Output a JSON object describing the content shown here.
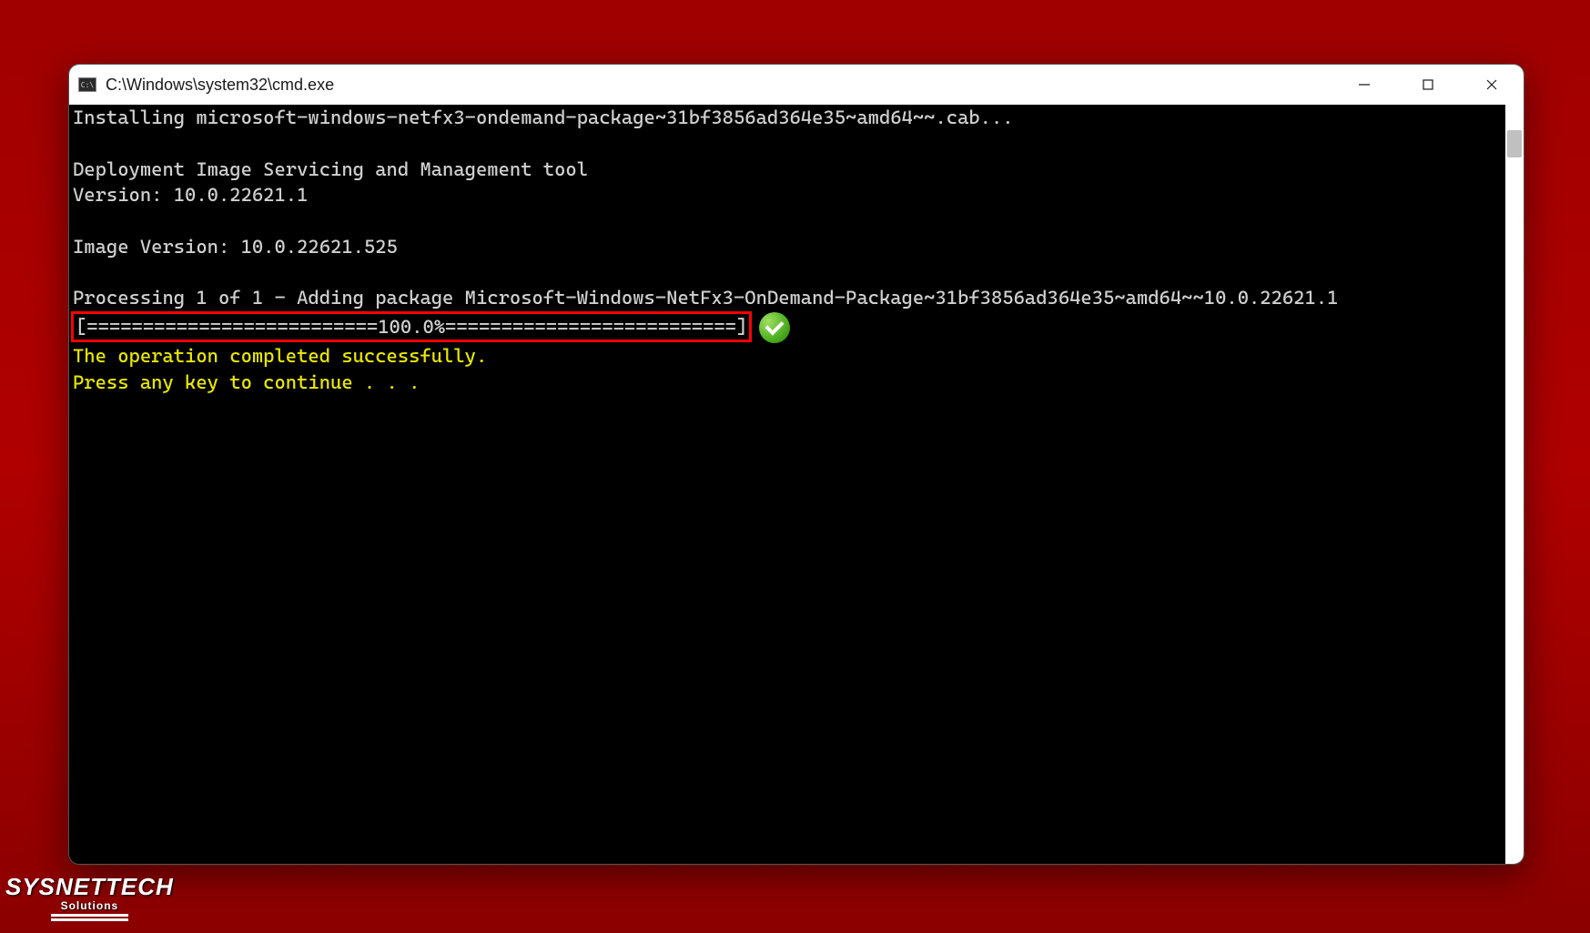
{
  "window": {
    "title": "C:\\Windows\\system32\\cmd.exe"
  },
  "terminal": {
    "line_installing": "Installing microsoft-windows-netfx3-ondemand-package~31bf3856ad364e35~amd64~~.cab...",
    "line_blank": "",
    "line_dism_title": "Deployment Image Servicing and Management tool",
    "line_version": "Version: 10.0.22621.1",
    "line_image_version": "Image Version: 10.0.22621.525",
    "line_processing": "Processing 1 of 1 - Adding package Microsoft-Windows-NetFx3-OnDemand-Package~31bf3856ad364e35~amd64~~10.0.22621.1",
    "progress_bar": "[==========================100.0%==========================]",
    "line_success": "The operation completed successfully.",
    "line_press_key": "Press any key to continue . . ."
  },
  "watermark": {
    "brand": "SYSNETTECH",
    "sub": "Solutions"
  }
}
